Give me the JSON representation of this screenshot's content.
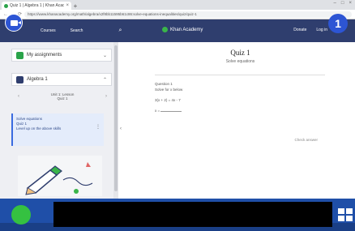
{
  "browser": {
    "tab_title": "Quiz 1 | Algebra 1 | Khan Academy",
    "tab_close": "×",
    "new_tab": "+",
    "window_controls": [
      "–",
      "□",
      "×"
    ],
    "nav": [
      "←",
      "→",
      "⟳"
    ],
    "url": "https://www.khanacademy.org/math/algebra/x2f8bb11595b61c86:solve-equations-inequalities/quiz/quiz-1"
  },
  "appbar": {
    "courses_label": "Courses",
    "search_label": "Search",
    "search_icon": "⌕",
    "brand_name": "Khan Academy",
    "donate_label": "Donate",
    "user_label": "Log in"
  },
  "sidebar": {
    "item_1": {
      "label": "My assignments",
      "chevron": "⌄"
    },
    "item_2": {
      "label": "Algebra 1",
      "chevron": "⌃"
    },
    "subnav": {
      "prev": "‹",
      "next": "›",
      "unit_label": "Unit 1: Lesson",
      "unit_name": "Quiz 1"
    },
    "card": {
      "heading": "Solve equations",
      "title": "Quiz 1",
      "subtitle": "Level up on the above skills",
      "more": "⋮"
    },
    "collapse": "‹"
  },
  "main": {
    "quiz_title": "Quiz 1",
    "quiz_sub": "Solve equations",
    "fields": {
      "label_1": "Question 1",
      "line_1": "Solve for x below",
      "line_2": "3(x + 2) = 4x - 7",
      "label_x": "x ="
    },
    "next_label": "Check answer"
  },
  "overlay": {
    "step_number": "1",
    "cam_icon": "video-camera-icon"
  },
  "colors": {
    "appbar": "#2f3e6e",
    "accent": "#2d55d4",
    "taskbar": "#1f4fa8",
    "start": "#35c141"
  }
}
